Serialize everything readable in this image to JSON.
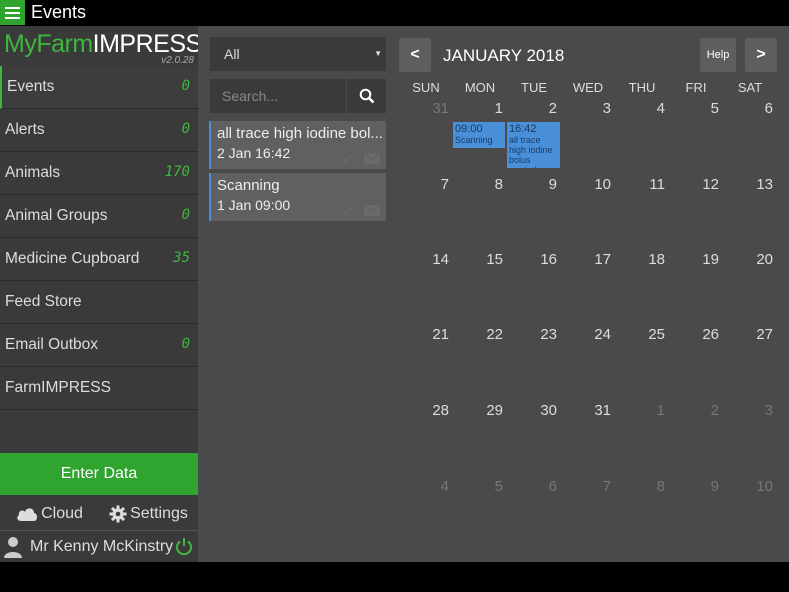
{
  "window": {
    "title": "Events"
  },
  "sidebar": {
    "logo": {
      "my": "My",
      "farm": "Farm",
      "impress": "IMPRESS",
      "version": "v2.0.28"
    },
    "items": [
      {
        "label": "Events",
        "count": "0",
        "active": true
      },
      {
        "label": "Alerts",
        "count": "0"
      },
      {
        "label": "Animals",
        "count": "170"
      },
      {
        "label": "Animal Groups",
        "count": "0"
      },
      {
        "label": "Medicine Cupboard",
        "count": "35"
      },
      {
        "label": "Feed Store",
        "count": ""
      },
      {
        "label": "Email Outbox",
        "count": "0"
      },
      {
        "label": "FarmIMPRESS",
        "count": ""
      }
    ],
    "enter_data": "Enter Data",
    "cloud": "Cloud",
    "settings": "Settings",
    "user": "Mr Kenny McKinstry"
  },
  "middle": {
    "filter": "All",
    "search_placeholder": "Search...",
    "events": [
      {
        "title": "all trace high iodine bol...",
        "date": "2 Jan 16:42"
      },
      {
        "title": "Scanning",
        "date": "1 Jan 09:00"
      }
    ]
  },
  "calendar": {
    "prev": "<",
    "next": ">",
    "help": "Help",
    "month": "JANUARY 2018",
    "weekdays": [
      "SUN",
      "MON",
      "TUE",
      "WED",
      "THU",
      "FRI",
      "SAT"
    ],
    "weeks": [
      [
        "31",
        "1",
        "2",
        "3",
        "4",
        "5",
        "6"
      ],
      [
        "7",
        "8",
        "9",
        "10",
        "11",
        "12",
        "13"
      ],
      [
        "14",
        "15",
        "16",
        "17",
        "18",
        "19",
        "20"
      ],
      [
        "21",
        "22",
        "23",
        "24",
        "25",
        "26",
        "27"
      ],
      [
        "28",
        "29",
        "30",
        "31",
        "1",
        "2",
        "3"
      ],
      [
        "4",
        "5",
        "6",
        "7",
        "8",
        "9",
        "10"
      ]
    ],
    "chips": [
      {
        "time": "09:00",
        "text": "Scanning"
      },
      {
        "time": "16:42",
        "text": "all trace high iodine bolus reminder"
      }
    ]
  },
  "colors": {
    "accent": "#2fa42f",
    "event": "#4a90d9"
  }
}
